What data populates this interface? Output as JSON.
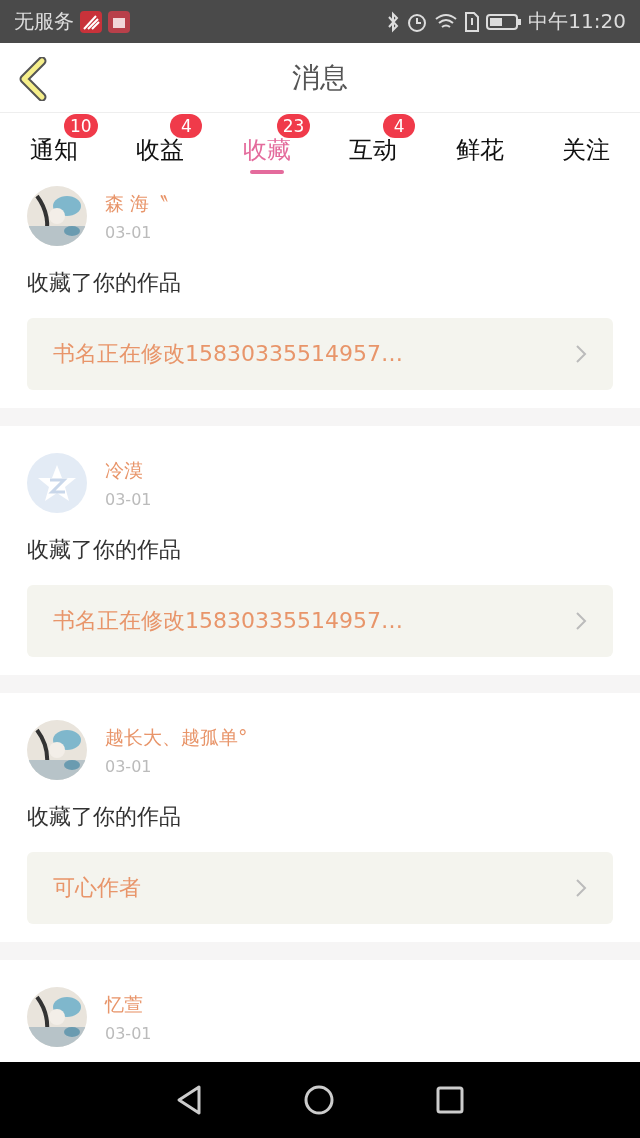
{
  "status_bar": {
    "carrier": "无服务",
    "time": "中午11:20"
  },
  "header": {
    "title": "消息"
  },
  "tabs": [
    {
      "label": "通知",
      "badge": "10",
      "selected": false
    },
    {
      "label": "收益",
      "badge": "4",
      "selected": false
    },
    {
      "label": "收藏",
      "badge": "23",
      "selected": true
    },
    {
      "label": "互动",
      "badge": "4",
      "selected": false
    },
    {
      "label": "鲜花",
      "selected": false
    },
    {
      "label": "关注",
      "selected": false
    }
  ],
  "messages": [
    {
      "name": "森 海〝",
      "date": "03-01",
      "text": "收藏了你的作品",
      "book": "书名正在修改15830335514957…"
    },
    {
      "name": "冷漠",
      "date": "03-01",
      "avatar": {
        "kind": "default"
      },
      "text": "收藏了你的作品",
      "book": "书名正在修改15830335514957…"
    },
    {
      "name": "越长大、越孤单°",
      "date": "03-01",
      "text": "收藏了你的作品",
      "book": "可心作者"
    },
    {
      "name": "忆萱",
      "date": "03-01"
    }
  ]
}
